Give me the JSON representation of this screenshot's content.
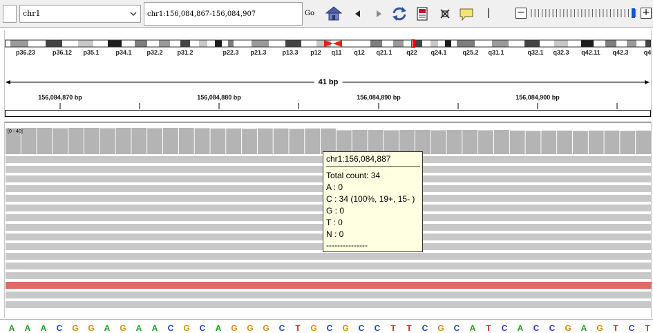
{
  "toolbar": {
    "chromosome": "chr1",
    "locus": "chr1:156,084,867-156,084,907",
    "go_label": "Go",
    "zoom_minus": "−",
    "zoom_plus": "+"
  },
  "ideogram": {
    "bands": [
      "p36.23",
      "p36.12",
      "p35.1",
      "p34.1",
      "p32.2",
      "p31.2",
      "p22.3",
      "p21.3",
      "p13.3",
      "p12",
      "q11",
      "q12",
      "q21.1",
      "q22",
      "q24.1",
      "q25.2",
      "q31.1",
      "q32.1",
      "q32.3",
      "q42.11",
      "q42.3",
      "q4"
    ],
    "centromere_color": "#e1201b",
    "current_region_color": "#ff0000"
  },
  "ruler": {
    "span_label": "41 bp",
    "ticks": [
      "156,084,870 bp",
      "156,084,880 bp",
      "156,084,890 bp",
      "156,084,900 bp"
    ]
  },
  "coverage": {
    "range_label": "[0 - 40]",
    "bar_color": "#b4b4b4"
  },
  "reads": {
    "row_color": "#c8c8c8",
    "highlight_color": "#dd6b66"
  },
  "sequence": {
    "bases": [
      "A",
      "A",
      "A",
      "C",
      "G",
      "G",
      "A",
      "G",
      "A",
      "A",
      "C",
      "G",
      "C",
      "A",
      "G",
      "G",
      "G",
      "C",
      "T",
      "G",
      "C",
      "G",
      "C",
      "C",
      "T",
      "T",
      "C",
      "G",
      "C",
      "A",
      "T",
      "C",
      "A",
      "C",
      "C",
      "G",
      "A",
      "G",
      "T",
      "C",
      "T"
    ],
    "colors": {
      "A": "#1f9b1f",
      "C": "#1a3fcc",
      "G": "#d18a12",
      "T": "#d11d1d"
    }
  },
  "tooltip": {
    "title": "chr1:156,084,887",
    "lines": [
      "Total count: 34",
      "A : 0",
      "C : 34 (100%, 19+, 15- )",
      "G : 0",
      "T : 0",
      "N : 0",
      "---------------"
    ]
  }
}
